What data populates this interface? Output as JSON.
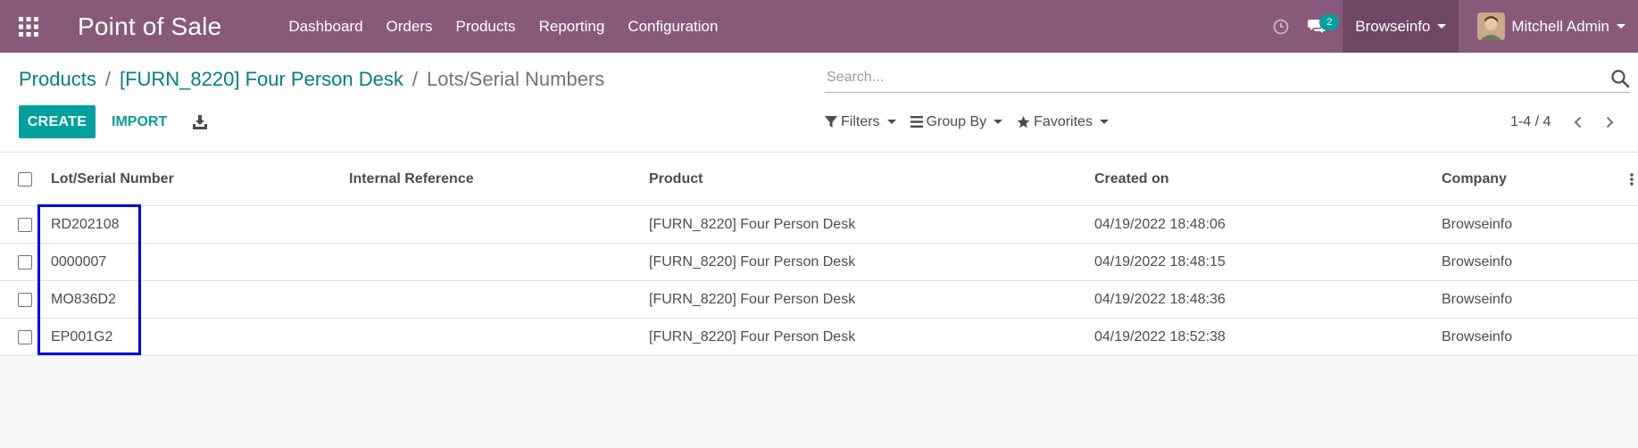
{
  "navbar": {
    "app_title": "Point of Sale",
    "menu": [
      "Dashboard",
      "Orders",
      "Products",
      "Reporting",
      "Configuration"
    ],
    "chat_count": "2",
    "company": "Browseinfo",
    "user": "Mitchell Admin"
  },
  "breadcrumb": {
    "first": "Products",
    "second": "[FURN_8220] Four Person Desk",
    "current": "Lots/Serial Numbers",
    "separator": "/"
  },
  "buttons": {
    "create": "CREATE",
    "import": "IMPORT"
  },
  "search": {
    "placeholder": "Search..."
  },
  "filters": {
    "filters_label": "Filters",
    "groupby_label": "Group By",
    "favorites_label": "Favorites"
  },
  "pager": {
    "value": "1-4 / 4"
  },
  "table": {
    "headers": {
      "lot": "Lot/Serial Number",
      "ref": "Internal Reference",
      "product": "Product",
      "created": "Created on",
      "company": "Company"
    },
    "rows": [
      {
        "lot": "RD202108",
        "ref": "",
        "product": "[FURN_8220] Four Person Desk",
        "created": "04/19/2022 18:48:06",
        "company": "Browseinfo"
      },
      {
        "lot": "0000007",
        "ref": "",
        "product": "[FURN_8220] Four Person Desk",
        "created": "04/19/2022 18:48:15",
        "company": "Browseinfo"
      },
      {
        "lot": "MO836D2",
        "ref": "",
        "product": "[FURN_8220] Four Person Desk",
        "created": "04/19/2022 18:48:36",
        "company": "Browseinfo"
      },
      {
        "lot": "EP001G2",
        "ref": "",
        "product": "[FURN_8220] Four Person Desk",
        "created": "04/19/2022 18:52:38",
        "company": "Browseinfo"
      }
    ]
  },
  "colors": {
    "navbar": "#875a7b",
    "accent": "#00a09d",
    "link": "#017e84",
    "highlight": "#0000e0"
  }
}
